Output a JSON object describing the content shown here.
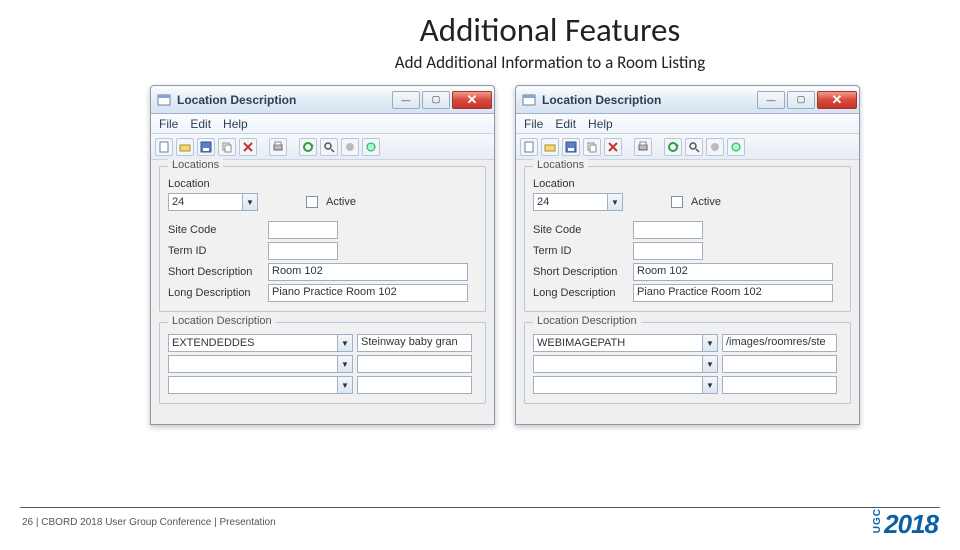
{
  "slide": {
    "title": "Additional Features",
    "subtitle": "Add Additional Information to a Room Listing"
  },
  "footer": {
    "page": "26",
    "sep": " |  ",
    "text": "CBORD 2018 User Group Conference | Presentation",
    "logo_small": "UGC",
    "logo_year": "2018"
  },
  "win_common": {
    "title": "Location Description",
    "menu": {
      "file": "File",
      "edit": "Edit",
      "help": "Help"
    },
    "group_locations": "Locations",
    "group_locdesc": "Location Description",
    "labels": {
      "location": "Location",
      "active": "Active",
      "sitecode": "Site Code",
      "termid": "Term ID",
      "shortdesc": "Short Description",
      "longdesc": "Long Description"
    },
    "values": {
      "location": "24",
      "sitecode": "",
      "termid": "",
      "shortdesc": "Room 102",
      "longdesc": "Piano Practice Room 102"
    }
  },
  "left": {
    "desc_key": "EXTENDEDDES",
    "desc_val": "Steinway baby gran"
  },
  "right": {
    "desc_key": "WEBIMAGEPATH",
    "desc_val": "/images/roomres/ste"
  }
}
